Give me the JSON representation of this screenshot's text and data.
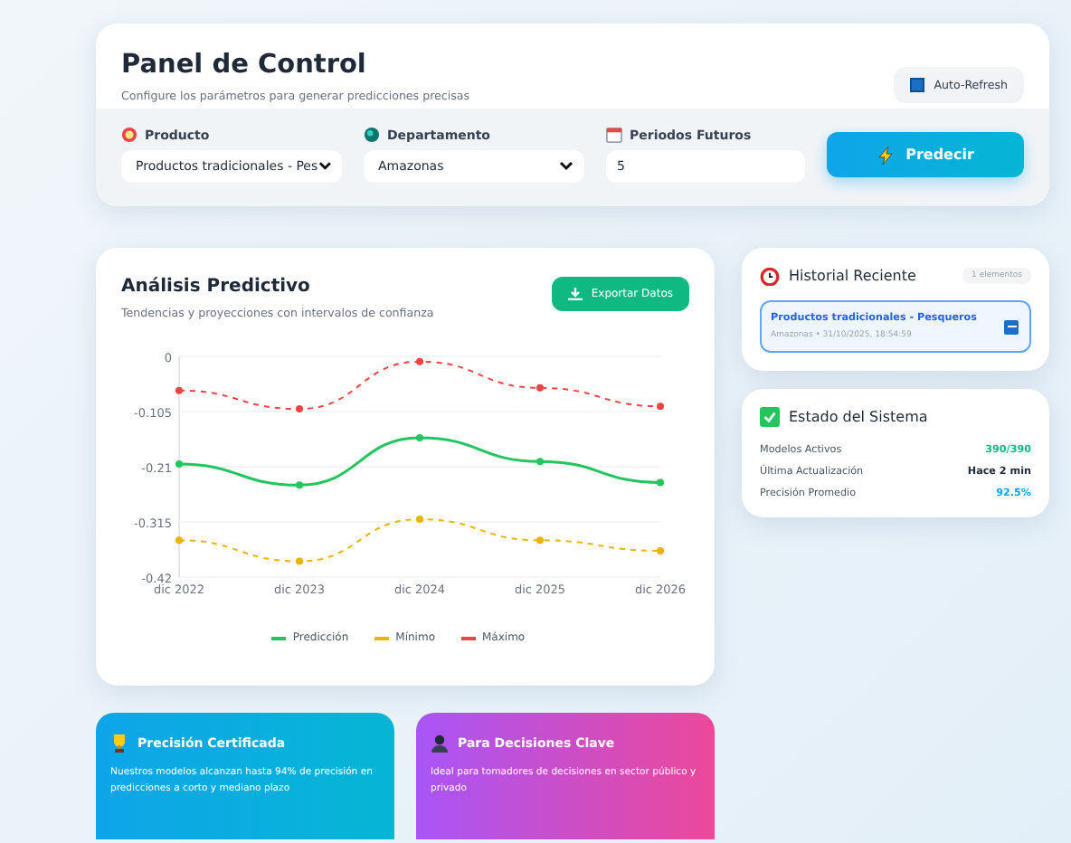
{
  "control_panel": {
    "title": "Panel de Control",
    "subtitle": "Configure los parámetros para generar predicciones precisas",
    "auto_refresh": {
      "label": "Auto-Refresh"
    },
    "fields": [
      {
        "kind": "select",
        "label": "Producto",
        "value": "Productos tradicionales - Pes"
      },
      {
        "kind": "select",
        "label": "Departamento",
        "value": "Amazonas"
      },
      {
        "kind": "number",
        "label": "Periodos Futuros",
        "value": "5"
      }
    ],
    "predict_button": "Predecir"
  },
  "analysis": {
    "title": "Análisis Predictivo",
    "subtitle": "Tendencias y proyecciones con intervalos de confianza",
    "export_button": "Exportar Datos",
    "chart_data": {
      "type": "line",
      "categories": [
        "dic 2022",
        "dic 2023",
        "dic 2024",
        "dic 2025",
        "dic 2026"
      ],
      "ylim": [
        -0.42,
        0
      ],
      "yticks": [
        0,
        -0.105,
        -0.21,
        -0.315,
        -0.42
      ],
      "grid": true,
      "legend": "bottom",
      "series": [
        {
          "name": "Predicción",
          "color": "#22c55e",
          "line_style": "solid",
          "marker": "circle",
          "values": [
            -0.205,
            -0.245,
            -0.155,
            -0.2,
            -0.24
          ]
        },
        {
          "name": "Mínimo",
          "color": "#eab308",
          "line_style": "dashed",
          "marker": "circle",
          "values": [
            -0.35,
            -0.39,
            -0.31,
            -0.35,
            -0.37
          ]
        },
        {
          "name": "Máximo",
          "color": "#ef4444",
          "line_style": "dashed",
          "marker": "circle",
          "values": [
            -0.065,
            -0.1,
            -0.01,
            -0.06,
            -0.095
          ]
        }
      ]
    }
  },
  "history": {
    "title": "Historial Reciente",
    "count": "1 elementos",
    "items": [
      {
        "title": "Productos tradicionales - Pesqueros",
        "meta": "Amazonas • 31/10/2025, 18:54:59"
      }
    ]
  },
  "system_status": {
    "title": "Estado del Sistema",
    "rows": [
      {
        "label": "Modelos Activos",
        "value": "390/390",
        "color": "#10b981"
      },
      {
        "label": "Última Actualización",
        "value": "Hace 2 min",
        "color": "#1f2937"
      },
      {
        "label": "Precisión Promedio",
        "value": "92.5%",
        "color": "#0ea5e9"
      }
    ]
  },
  "feature_cards": [
    {
      "kind": "trophy",
      "title": "Precisión Certificada",
      "text": "Nuestros modelos alcanzan hasta 94% de precisión en predicciones a corto y mediano plazo"
    },
    {
      "kind": "person",
      "title": "Para Decisiones Clave",
      "text": "Ideal para tomadores de decisiones en sector público y privado"
    }
  ]
}
